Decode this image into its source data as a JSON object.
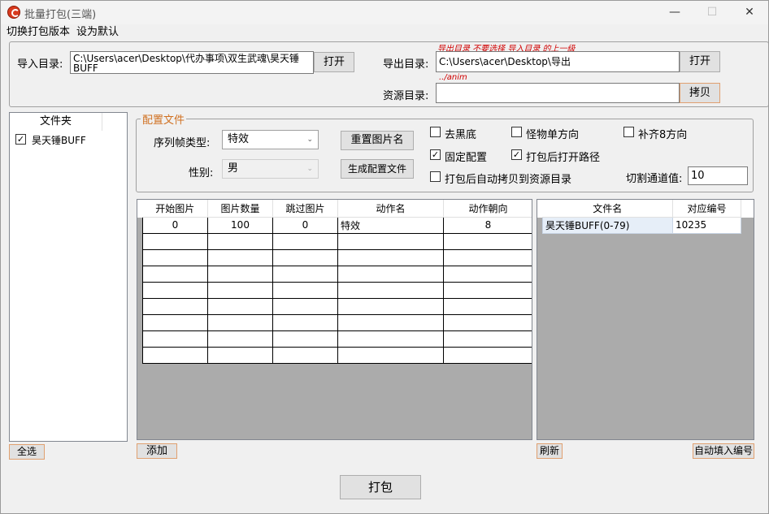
{
  "window": {
    "title": "批量打包(三端)",
    "minimize": "—",
    "maximize": "☐",
    "close": "✕"
  },
  "menu": {
    "items": [
      "切换打包版本",
      "设为默认"
    ]
  },
  "dirs": {
    "import_label": "导入目录:",
    "import_value": "C:\\Users\\acer\\Desktop\\代办事项\\双生武魂\\昊天锤BUFF",
    "import_open": "打开",
    "export_note": "导出目录 不要选择 导入目录 的上一级",
    "export_label": "导出目录:",
    "export_value": "C:\\Users\\acer\\Desktop\\导出",
    "export_open": "打开",
    "resource_note": "../anim",
    "resource_label": "资源目录:",
    "resource_value": "",
    "copy_button": "拷贝"
  },
  "folders": {
    "header": "文件夹",
    "items": [
      {
        "label": "昊天锤BUFF",
        "checked": true
      }
    ],
    "select_all": "全选"
  },
  "config": {
    "group_title": "配置文件",
    "seq_type_label": "序列帧类型:",
    "seq_type_value": "特效",
    "gender_label": "性别:",
    "gender_value": "男",
    "rename_button": "重置图片名",
    "generate_button": "生成配置文件",
    "options": [
      {
        "label": "去黑底",
        "checked": false
      },
      {
        "label": "怪物单方向",
        "checked": false
      },
      {
        "label": "补齐8方向",
        "checked": false
      },
      {
        "label": "固定配置",
        "checked": true
      },
      {
        "label": "打包后打开路径",
        "checked": true
      },
      {
        "label": "打包后自动拷贝到资源目录",
        "checked": false
      }
    ],
    "threshold_label": "切割通道值:",
    "threshold_value": "10"
  },
  "actions_table": {
    "columns": [
      "开始图片",
      "图片数量",
      "跳过图片",
      "动作名",
      "动作朝向"
    ],
    "rows": [
      [
        "0",
        "100",
        "0",
        "特效",
        "8"
      ]
    ],
    "add_button": "添加"
  },
  "files_table": {
    "columns": [
      "文件名",
      "对应编号"
    ],
    "rows": [
      [
        "昊天锤BUFF(0-79)",
        "10235"
      ]
    ],
    "refresh_button": "刷新",
    "auto_fill_button": "自动填入编号"
  },
  "pack_button": "打包"
}
